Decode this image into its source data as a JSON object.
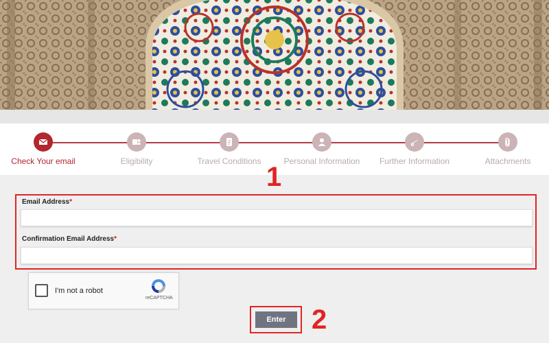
{
  "stepper": {
    "steps": [
      {
        "label": "Check Your email",
        "icon": "envelope-icon",
        "active": true
      },
      {
        "label": "Eligibility",
        "icon": "eligibility-icon",
        "active": false
      },
      {
        "label": "Travel Conditions",
        "icon": "document-icon",
        "active": false
      },
      {
        "label": "Personal Information",
        "icon": "person-icon",
        "active": false
      },
      {
        "label": "Further Information",
        "icon": "plane-icon",
        "active": false
      },
      {
        "label": "Attachments",
        "icon": "paperclip-icon",
        "active": false
      }
    ],
    "active_color": "#b2262f",
    "inactive_color": "#cbb3b6"
  },
  "form": {
    "email_label": "Email Address",
    "confirm_label": "Confirmation Email Address",
    "required_mark": "*",
    "email_value": "",
    "confirm_value": ""
  },
  "captcha": {
    "label": "I'm not a robot",
    "brand": "reCAPTCHA"
  },
  "enter_button": {
    "label": "Enter"
  },
  "annotations": {
    "one": "1",
    "two": "2",
    "color": "#e02424"
  }
}
